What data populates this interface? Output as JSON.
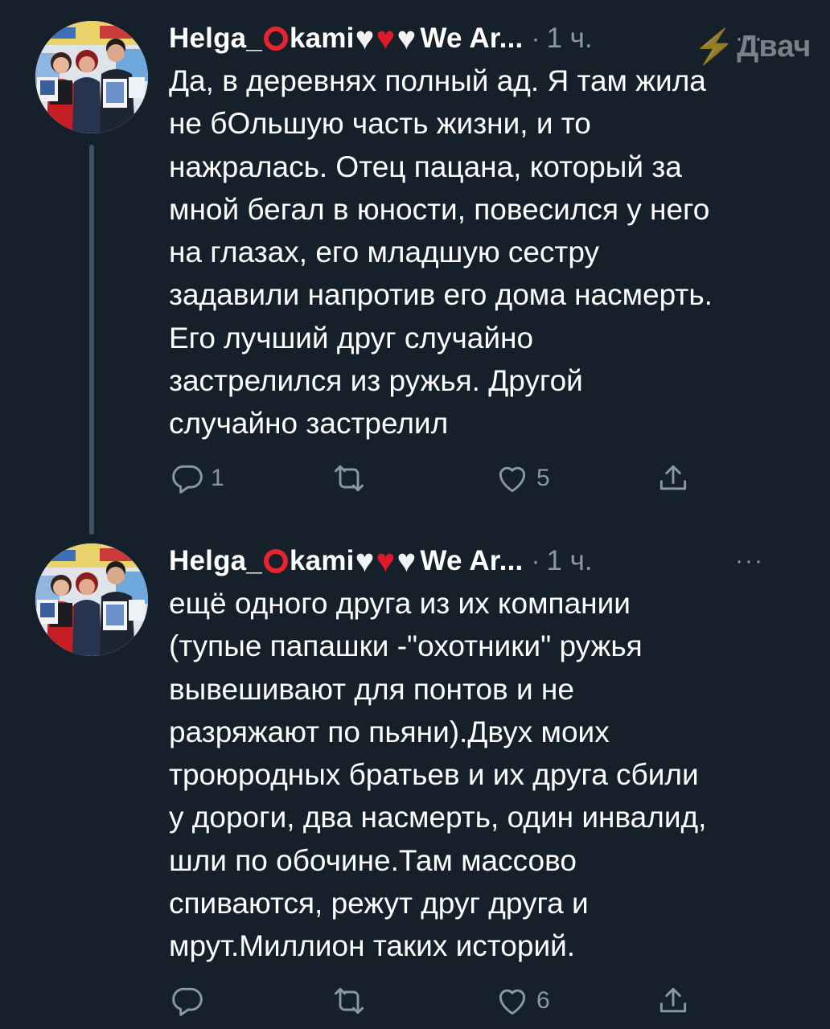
{
  "theme": {
    "background": "#15202b",
    "text": "#ffffff",
    "muted": "#8899a6",
    "thread_line": "#3d5466",
    "ring": "#e8242e"
  },
  "watermark": {
    "text": "Двач"
  },
  "tweets": [
    {
      "author_prefix": "Helga_",
      "author_emoji": [
        "white-heart",
        "red-heart",
        "white-heart"
      ],
      "author_suffix": "We Ar...",
      "separator": "·",
      "time": "1 ч.",
      "more": "···",
      "text": "Да, в деревнях полный ад. Я там жила\nне бОльшую часть жизни, и то\nнажралась. Отец пацана, который за\nмной бегал в юности, повесился у него\nна глазах, его младшую сестру\nзадавили напротив его дома насмерть.\nЕго лучший друг случайно\nзастрелился из ружья. Другой\nслучайно застрелил",
      "replies": "1",
      "retweets": "",
      "likes": "5"
    },
    {
      "author_prefix": "Helga_",
      "author_emoji": [
        "white-heart",
        "red-heart",
        "white-heart"
      ],
      "author_suffix": "We Ar...",
      "separator": "·",
      "time": "1 ч.",
      "more": "···",
      "text": "ещё одного друга из их компании\n(тупые папашки -\"охотники\" ружья\nвывешивают для понтов и не\nразряжают по пьяни).Двух моих\nтроюродных братьев и их друга сбили\nу дороги, два насмерть, один инвалид,\nшли по обочине.Там массово\nспиваются, режут друг друга и\nмрут.Миллион таких историй.",
      "replies": "",
      "retweets": "",
      "likes": "6"
    }
  ],
  "author_name_mid": "kami",
  "heart_glyph": "♥"
}
